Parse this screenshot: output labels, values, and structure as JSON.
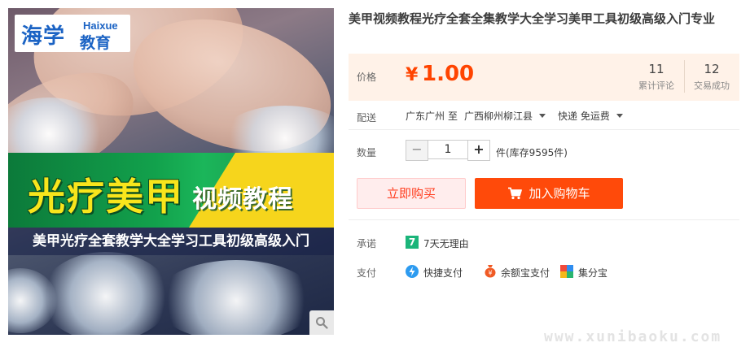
{
  "product_image": {
    "brand_main": "海学",
    "brand_latin": "Haixue",
    "brand_sub": "教育",
    "banner_title": "光疗美甲",
    "banner_subtitle": "视频教程",
    "banner_caption": "美甲光疗全套教学大全学习工具初级高级入门"
  },
  "product": {
    "title": "美甲视频教程光疗全套全集教学大全学习美甲工具初级高级入门专业"
  },
  "price": {
    "label": "价格",
    "currency": "¥",
    "value": "1.00",
    "reviews_count": "11",
    "reviews_label": "累计评论",
    "sales_count": "12",
    "sales_label": "交易成功"
  },
  "shipping": {
    "label": "配送",
    "origin": "广东广州",
    "to": "至",
    "destination": "广西柳州柳江县",
    "method": "快递 免运费"
  },
  "quantity": {
    "label": "数量",
    "minus": "−",
    "value": "1",
    "plus": "+",
    "stock_text": "件(库存9595件)"
  },
  "actions": {
    "buy_now": "立即购买",
    "add_to_cart": "加入购物车"
  },
  "promise": {
    "label": "承诺",
    "icon_text": "7",
    "item": "7天无理由"
  },
  "payment": {
    "label": "支付",
    "methods": [
      "快捷支付",
      "余额宝支付",
      "集分宝"
    ]
  },
  "watermark": "www.xunibaoku.com",
  "colors": {
    "accent": "#ff4400",
    "price_panel_bg": "#fff2e8",
    "buy_now_bg": "#ffeded",
    "cart_bg": "#ff4a0a",
    "brand_blue": "#1b63c4"
  },
  "icons": {
    "zoom": "magnifier-icon",
    "cart": "cart-icon",
    "promise": "seven-day-return-icon",
    "payment": [
      "quick-pay-icon",
      "yuebao-icon",
      "jifenbao-icon"
    ]
  }
}
